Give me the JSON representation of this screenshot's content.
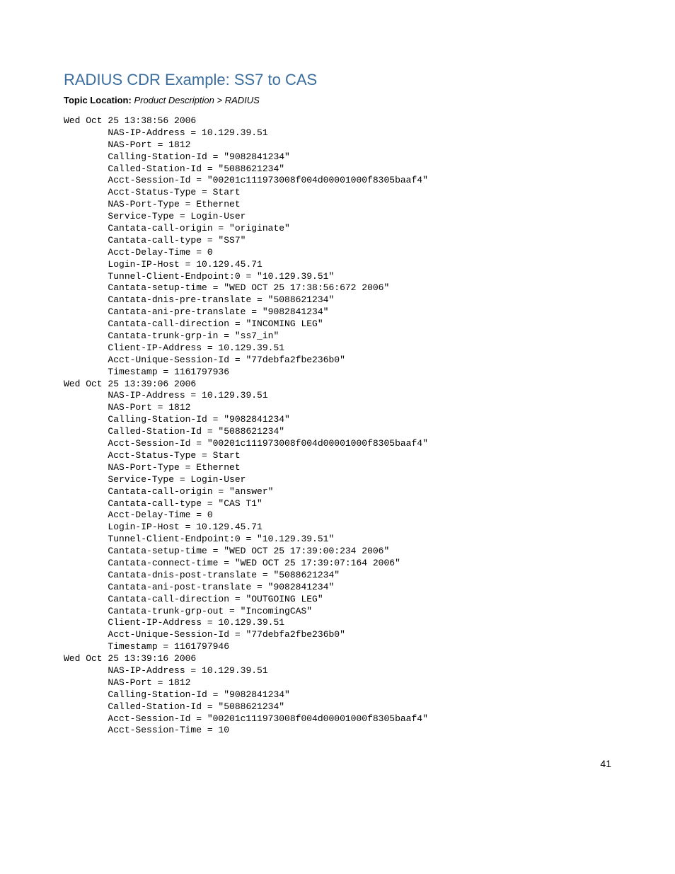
{
  "heading": "RADIUS CDR Example: SS7 to CAS",
  "topic_label": "Topic Location:",
  "topic_path": "Product Description > RADIUS",
  "page_number": "41",
  "records": [
    {
      "timestamp": "Wed Oct 25 13:38:56 2006",
      "lines": [
        "NAS-IP-Address = 10.129.39.51",
        "NAS-Port = 1812",
        "Calling-Station-Id = \"9082841234\"",
        "Called-Station-Id = \"5088621234\"",
        "Acct-Session-Id = \"00201c111973008f004d00001000f8305baaf4\"",
        "Acct-Status-Type = Start",
        "NAS-Port-Type = Ethernet",
        "Service-Type = Login-User",
        "Cantata-call-origin = \"originate\"",
        "Cantata-call-type = \"SS7\"",
        "Acct-Delay-Time = 0",
        "Login-IP-Host = 10.129.45.71",
        "Tunnel-Client-Endpoint:0 = \"10.129.39.51\"",
        "Cantata-setup-time = \"WED OCT 25 17:38:56:672 2006\"",
        "Cantata-dnis-pre-translate = \"5088621234\"",
        "Cantata-ani-pre-translate = \"9082841234\"",
        "Cantata-call-direction = \"INCOMING LEG\"",
        "Cantata-trunk-grp-in = \"ss7_in\"",
        "Client-IP-Address = 10.129.39.51",
        "Acct-Unique-Session-Id = \"77debfa2fbe236b0\"",
        "Timestamp = 1161797936"
      ]
    },
    {
      "timestamp": "Wed Oct 25 13:39:06 2006",
      "lines": [
        "NAS-IP-Address = 10.129.39.51",
        "NAS-Port = 1812",
        "Calling-Station-Id = \"9082841234\"",
        "Called-Station-Id = \"5088621234\"",
        "Acct-Session-Id = \"00201c111973008f004d00001000f8305baaf4\"",
        "Acct-Status-Type = Start",
        "NAS-Port-Type = Ethernet",
        "Service-Type = Login-User",
        "Cantata-call-origin = \"answer\"",
        "Cantata-call-type = \"CAS T1\"",
        "Acct-Delay-Time = 0",
        "Login-IP-Host = 10.129.45.71",
        "Tunnel-Client-Endpoint:0 = \"10.129.39.51\"",
        "Cantata-setup-time = \"WED OCT 25 17:39:00:234 2006\"",
        "Cantata-connect-time = \"WED OCT 25 17:39:07:164 2006\"",
        "Cantata-dnis-post-translate = \"5088621234\"",
        "Cantata-ani-post-translate = \"9082841234\"",
        "Cantata-call-direction = \"OUTGOING LEG\"",
        "Cantata-trunk-grp-out = \"IncomingCAS\"",
        "Client-IP-Address = 10.129.39.51",
        "Acct-Unique-Session-Id = \"77debfa2fbe236b0\"",
        "Timestamp = 1161797946"
      ]
    },
    {
      "timestamp": "Wed Oct 25 13:39:16 2006",
      "lines": [
        "NAS-IP-Address = 10.129.39.51",
        "NAS-Port = 1812",
        "Calling-Station-Id = \"9082841234\"",
        "Called-Station-Id = \"5088621234\"",
        "Acct-Session-Id = \"00201c111973008f004d00001000f8305baaf4\"",
        "Acct-Session-Time = 10"
      ]
    }
  ]
}
